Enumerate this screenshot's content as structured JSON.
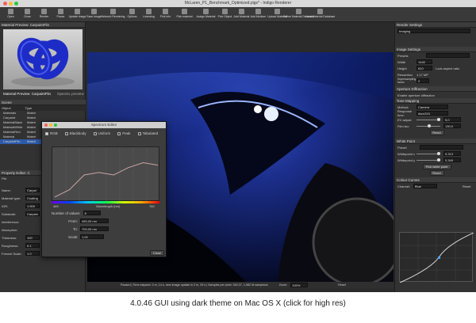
{
  "window": {
    "title": "McLaren_P1_Benchmark_Optimized.pigs* - Indigo Renderer"
  },
  "toolbar": [
    {
      "label": "Open",
      "icon": "folder-icon"
    },
    {
      "label": "Close",
      "icon": "close-icon"
    },
    {
      "label": "Render",
      "icon": "render-icon"
    },
    {
      "label": "Pause",
      "icon": "pause-icon"
    },
    {
      "label": "Update image",
      "icon": "refresh-icon"
    },
    {
      "label": "Save image",
      "icon": "save-icon"
    },
    {
      "label": "Network Rendering",
      "icon": "network-icon"
    },
    {
      "label": "Options",
      "icon": "gear-icon"
    },
    {
      "label": "Licensing",
      "icon": "key-icon"
    },
    {
      "label": "Pick info",
      "icon": "info-icon"
    },
    {
      "label": "Pick material",
      "icon": "picker-icon"
    },
    {
      "label": "Assign Material",
      "icon": "brush-icon"
    },
    {
      "label": "Pick Object",
      "icon": "cursor-icon"
    },
    {
      "label": "Add Material",
      "icon": "plus-icon"
    },
    {
      "label": "Add Medium",
      "icon": "plus-icon"
    },
    {
      "label": "Upload Material",
      "icon": "upload-icon"
    },
    {
      "label": "Online Material Database",
      "icon": "globe-icon"
    },
    {
      "label": "Local Material Database",
      "icon": "database-icon"
    }
  ],
  "material_preview": {
    "header": "Material Preview: CarpaintFlin",
    "tab1": "Material Preview: CarpaintFlin",
    "tab2": "OpenGL preview"
  },
  "scene": {
    "header": "Scene",
    "col_object": "Object",
    "col_type": "Type",
    "rows": [
      [
        "Materials",
        "Materi"
      ],
      [
        "Carpaint",
        "Materi"
      ],
      [
        "MaterialBlack",
        "Materi"
      ],
      [
        "MaterialWhite",
        "Materi"
      ],
      [
        "MaterialRed",
        "Materi"
      ],
      [
        "Material",
        "Materi"
      ],
      [
        "CarpaintFlin",
        "Materi"
      ]
    ]
  },
  "property_editor": {
    "header": "Property Editor: C",
    "file": "File",
    "fields": [
      {
        "label": "Name:",
        "value": "Carpai"
      },
      {
        "label": "Material type:",
        "value": "Coating"
      },
      {
        "label": "IOR:",
        "value": "1.500"
      },
      {
        "label": "Substrate:",
        "value": "Carpain"
      },
      {
        "label": "Interference:",
        "value": ""
      },
      {
        "label": "Absorption:",
        "value": ""
      },
      {
        "label": "Thickness:",
        "value": "100"
      },
      {
        "label": "Roughness:",
        "value": "0.1"
      },
      {
        "label": "Fresnel Scale:",
        "value": "1.0"
      }
    ],
    "none1": "none",
    "none2": "none"
  },
  "spectrum": {
    "title": "Spectrum Editor",
    "modes": [
      "RGB",
      "Blackbody",
      "Uniform",
      "Peak",
      "Tabulated"
    ],
    "x_min": "469",
    "x_max": "760",
    "x_label": "Wavelength (nm)",
    "num_values_label": "Number of values:",
    "num_values": "8",
    "from_label": "From:",
    "from_value": "450,00 nm",
    "to_label": "To:",
    "to_value": "700,00 nm",
    "scale_label": "Scale:",
    "scale_value": "1,00",
    "close": "Close",
    "curve": [
      0.05,
      0.2,
      0.5,
      0.55,
      0.5,
      0.65,
      0.75,
      0.7
    ]
  },
  "render_settings": {
    "header": "Render Settings",
    "preset": "Imaging",
    "image_settings": "Image Settings",
    "presets_label": "Presets",
    "width_label": "Width",
    "width": "1440",
    "height_label": "Height",
    "height": "810",
    "lock_label": "Lock aspect ratio",
    "resolution_label": "Resolution",
    "resolution": "1.17 MP",
    "ss_label": "Supersampling factor",
    "ss": "2",
    "aperture": "Aperture Diffraction",
    "enable_ad": "Enable aperture diffraction",
    "tone": "Tone Mapping",
    "method_label": "Method:",
    "method": "Camera",
    "resp_label": "Response func:",
    "resp": "dscs315",
    "ev_label": "EV adjust:",
    "ev": "5,0",
    "film_label": "Film iso:",
    "film": "130,0",
    "reset": "Reset",
    "white": "White Point",
    "preset_label": "Preset",
    "wp_x_label": "Whitepoint x",
    "wp_x": "0,313",
    "wp_y_label": "Whitepoint y",
    "wp_y": "0,349",
    "pick_wp": "Pick white point",
    "reset2": "Reset",
    "curves": "Colour Curves",
    "channel_label": "Channel:",
    "channel": "Blue",
    "reset3": "Reset"
  },
  "status": {
    "text": "Paused | Time elapsed: 3 m, 14 s, next image update in 2 m, 25 s | Samples per pixel: 345.37, 1,982 M samples/s",
    "zoom_label": "Zoom:",
    "zoom": "100%",
    "reset": "Reset"
  },
  "caption": "4.0.46 GUI using dark theme on Mac OS X (click for high res)"
}
